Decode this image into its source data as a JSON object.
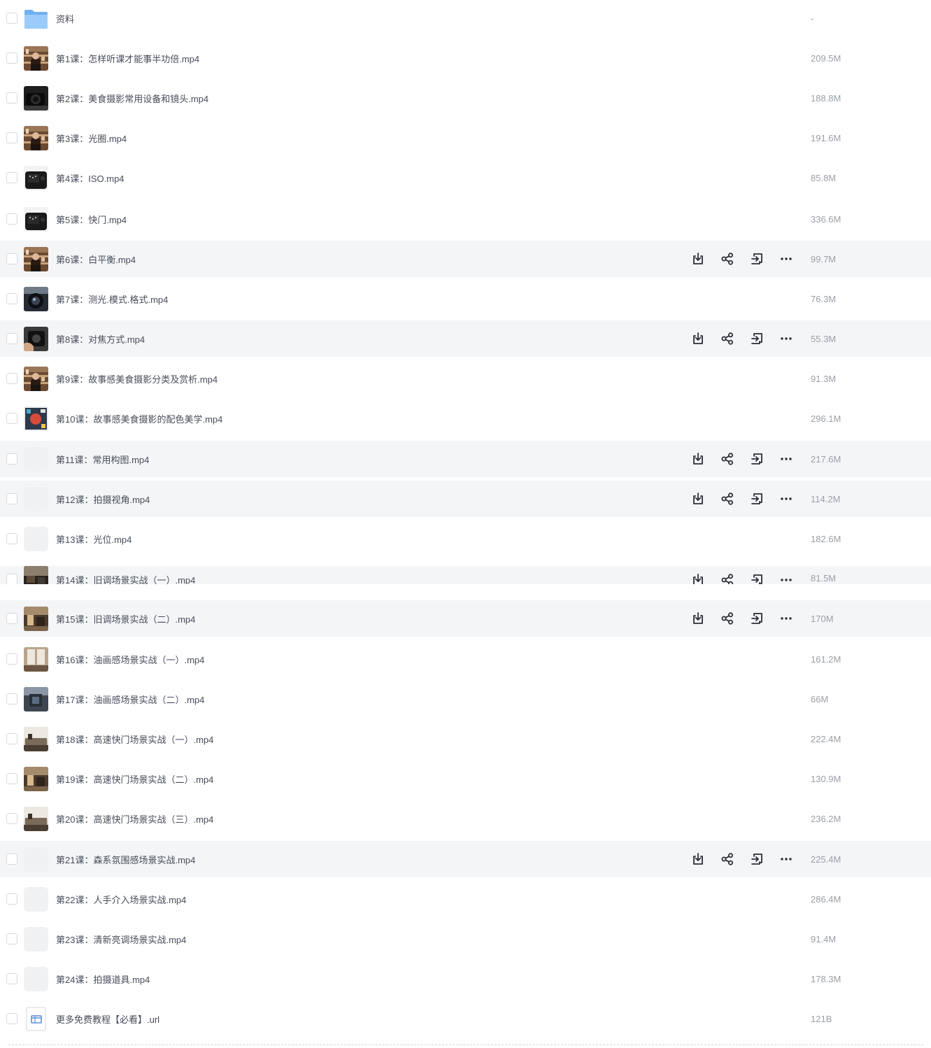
{
  "files": [
    {
      "name": "资料",
      "size": "-",
      "type": "folder"
    },
    {
      "name": "第1课：怎样听课才能事半功倍.mp4",
      "size": "209.5M",
      "type": "video",
      "thumb": "shelves"
    },
    {
      "name": "第2课：美食摄影常用设备和镜头.mp4",
      "size": "188.8M",
      "type": "video",
      "thumb": "dark-camera"
    },
    {
      "name": "第3课：光圈.mp4",
      "size": "191.6M",
      "type": "video",
      "thumb": "shelves"
    },
    {
      "name": "第4课：ISO.mp4",
      "size": "85.8M",
      "type": "video",
      "thumb": "camera-back"
    },
    {
      "name": "第5课：快门.mp4",
      "size": "336.6M",
      "type": "video",
      "thumb": "camera-back"
    },
    {
      "name": "第6课：白平衡.mp4",
      "size": "99.7M",
      "type": "video",
      "thumb": "shelves",
      "hover": true
    },
    {
      "name": "第7课：测光.模式.格式.mp4",
      "size": "76.3M",
      "type": "video",
      "thumb": "lens"
    },
    {
      "name": "第8课：对焦方式.mp4",
      "size": "55.3M",
      "type": "video",
      "thumb": "hand-camera",
      "hover": true
    },
    {
      "name": "第9课：故事感美食摄影分类及赏析.mp4",
      "size": "91.3M",
      "type": "video",
      "thumb": "shelves"
    },
    {
      "name": "第10课：故事感美食摄影的配色美学.mp4",
      "size": "296.1M",
      "type": "video",
      "thumb": "color-slide"
    },
    {
      "name": "第11课：常用构图.mp4",
      "size": "217.6M",
      "type": "video",
      "thumb": "blank",
      "hover": true
    },
    {
      "name": "第12课：拍摄视角.mp4",
      "size": "114.2M",
      "type": "video",
      "thumb": "blank",
      "hover": true
    },
    {
      "name": "第13课：光位.mp4",
      "size": "182.6M",
      "type": "video",
      "thumb": "blank"
    },
    {
      "name": "第14课：旧调场景实战（一）.mp4",
      "size": "81.5M",
      "type": "video",
      "thumb": "scene-dark",
      "hover": true,
      "clipped": true
    },
    {
      "name": "第15课：旧调场景实战（二）.mp4",
      "size": "170M",
      "type": "video",
      "thumb": "scene-warm",
      "hover": true
    },
    {
      "name": "第16课：油画感场景实战（一）.mp4",
      "size": "161.2M",
      "type": "video",
      "thumb": "window"
    },
    {
      "name": "第17课：油画感场景实战（二）.mp4",
      "size": "66M",
      "type": "video",
      "thumb": "scene-blue"
    },
    {
      "name": "第18课：高速快门场景实战（一）.mp4",
      "size": "222.4M",
      "type": "video",
      "thumb": "scene-room"
    },
    {
      "name": "第19课：高速快门场景实战（二）.mp4",
      "size": "130.9M",
      "type": "video",
      "thumb": "scene-warm"
    },
    {
      "name": "第20课：高速快门场景实战（三）.mp4",
      "size": "236.2M",
      "type": "video",
      "thumb": "scene-room"
    },
    {
      "name": "第21课：森系氛围感场景实战.mp4",
      "size": "225.4M",
      "type": "video",
      "thumb": "blank",
      "hover": true
    },
    {
      "name": "第22课：人手介入场景实战.mp4",
      "size": "286.4M",
      "type": "video",
      "thumb": "blank"
    },
    {
      "name": "第23课：清新亮调场景实战.mp4",
      "size": "91.4M",
      "type": "video",
      "thumb": "blank"
    },
    {
      "name": "第24课：拍摄道具.mp4",
      "size": "178.3M",
      "type": "video",
      "thumb": "blank"
    },
    {
      "name": "更多免费教程【必看】.url",
      "size": "121B",
      "type": "url"
    }
  ],
  "actions": [
    {
      "icon": "download-icon",
      "label": "download"
    },
    {
      "icon": "share-icon",
      "label": "share"
    },
    {
      "icon": "move-icon",
      "label": "move"
    },
    {
      "icon": "more-icon",
      "label": "more"
    }
  ],
  "colors": {
    "hover_row": "#f4f5f7",
    "filename": "#454d5a",
    "size": "#9aa0a8",
    "folder": "#7fb8f5"
  }
}
